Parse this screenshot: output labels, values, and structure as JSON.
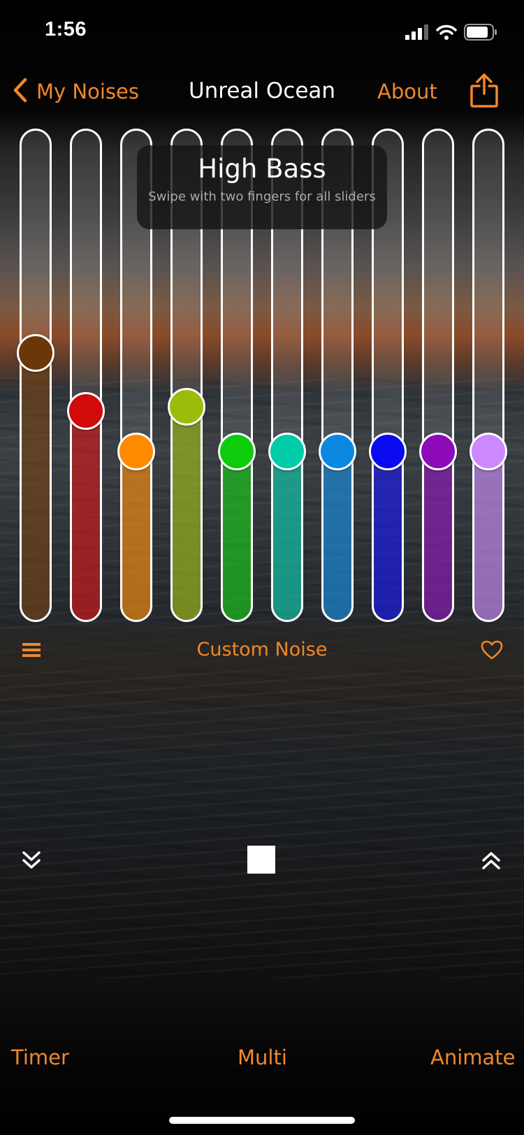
{
  "status_bar": {
    "time": "1:56"
  },
  "nav": {
    "back_label": "My Noises",
    "title": "Unreal Ocean",
    "about_label": "About"
  },
  "tooltip": {
    "title": "High Bass",
    "subtitle": "Swipe with two fingers for all sliders"
  },
  "sliders": [
    {
      "color": "#6b3708",
      "level": 0.55
    },
    {
      "color": "#d10a0a",
      "level": 0.42
    },
    {
      "color": "#ff8a00",
      "level": 0.33
    },
    {
      "color": "#9cbc0a",
      "level": 0.43
    },
    {
      "color": "#0ccc0c",
      "level": 0.33
    },
    {
      "color": "#00ccaa",
      "level": 0.33
    },
    {
      "color": "#0a88e0",
      "level": 0.33
    },
    {
      "color": "#0a0af0",
      "level": 0.33
    },
    {
      "color": "#8c0ab8",
      "level": 0.33
    },
    {
      "color": "#cc88ff",
      "level": 0.33
    }
  ],
  "preset": {
    "name": "Custom Noise"
  },
  "bottom_tabs": {
    "timer": "Timer",
    "multi": "Multi",
    "animate": "Animate"
  },
  "colors": {
    "accent": "#f0882a"
  },
  "icons": {
    "back": "chevron-left-icon",
    "share": "share-icon",
    "menu": "hamburger-icon",
    "favorite": "heart-icon",
    "collapse": "double-chevron-down-icon",
    "stop": "stop-icon",
    "expand": "double-chevron-up-icon"
  }
}
